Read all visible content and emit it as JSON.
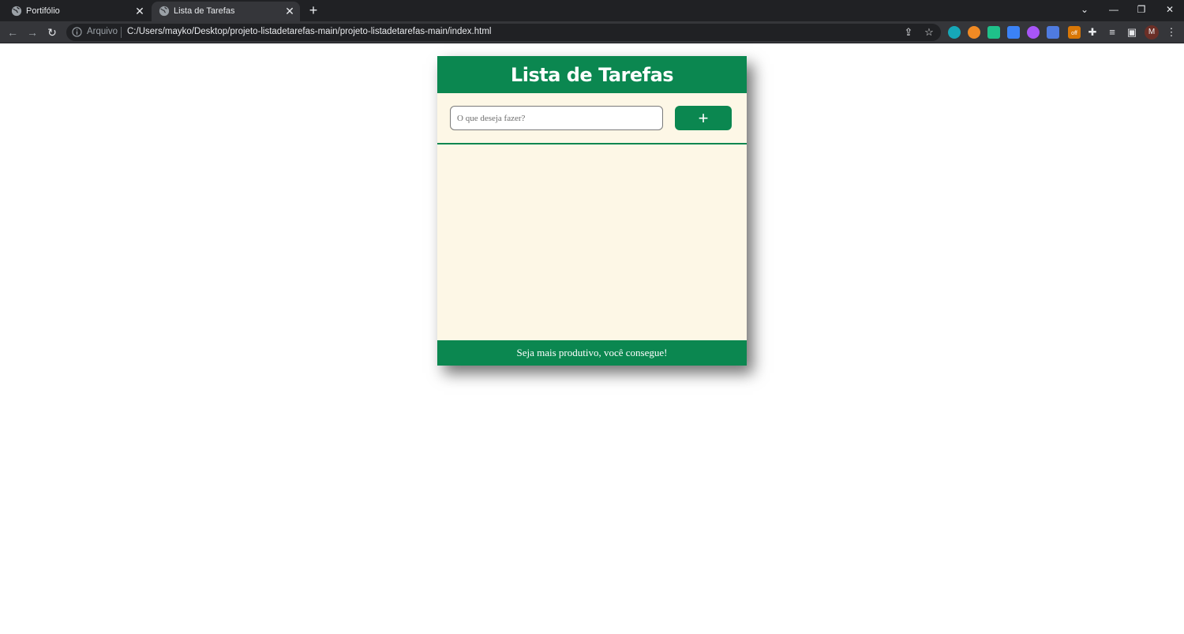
{
  "browser": {
    "tabs": [
      {
        "title": "Portifólio",
        "active": false
      },
      {
        "title": "Lista de Tarefas",
        "active": true
      }
    ],
    "new_tab_label": "+",
    "address_bar": {
      "scheme_label": "Arquivo",
      "url": "C:/Users/mayko/Desktop/projeto-listadetarefas-main/projeto-listadetarefas-main/index.html"
    },
    "profile_initial": "M",
    "extension_badge": "off"
  },
  "app": {
    "title": "Lista de Tarefas",
    "input_placeholder": "O que deseja fazer?",
    "input_value": "",
    "add_button_label": "+",
    "tasks": [],
    "footer_text": "Seja mais produtivo, você consegue!"
  },
  "colors": {
    "primary_green": "#0b8750",
    "list_background": "#fdf7e6",
    "chrome_dark": "#202124",
    "chrome_toolbar": "#35363a"
  }
}
